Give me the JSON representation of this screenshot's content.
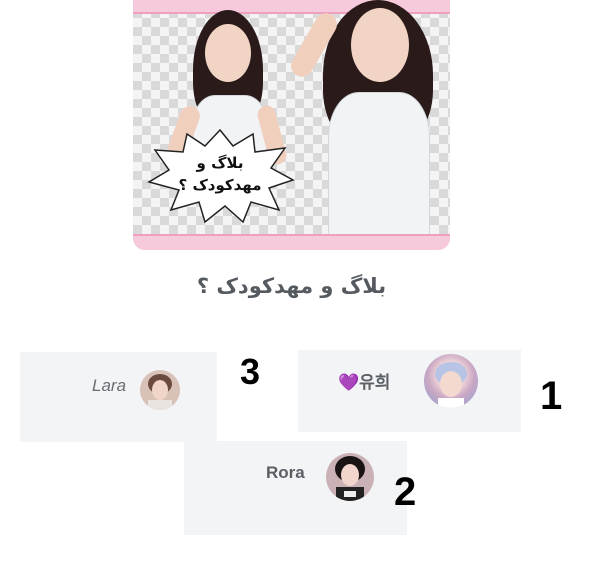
{
  "post": {
    "image_caption": "بلاگ و مهدکودک ؟",
    "title": "بلاگ و مهدکودک ؟"
  },
  "leaderboard": [
    {
      "rank": "1",
      "name": "💜유희"
    },
    {
      "rank": "2",
      "name": "Rora"
    },
    {
      "rank": "3",
      "name": "Lara"
    }
  ],
  "colors": {
    "card_bg": "#f3f4f6",
    "name_text": "#5a5f66",
    "rank_text": "#000000",
    "heart": "#9b5de5"
  }
}
